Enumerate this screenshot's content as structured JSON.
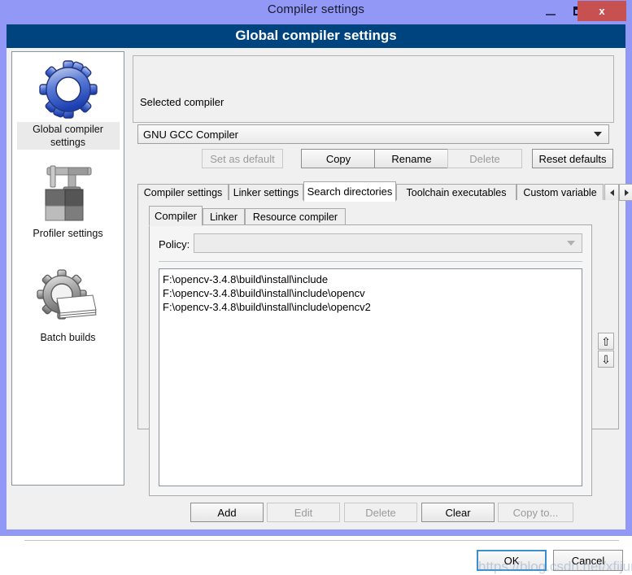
{
  "window": {
    "title": "Compiler settings",
    "minimize_label": "minimize",
    "maximize_label": "restore",
    "close_label": "x",
    "titlebar_color": "#9198f5",
    "header_color": "#00447f"
  },
  "header": {
    "title": "Global compiler settings"
  },
  "sidebar": {
    "items": [
      {
        "label": "Global compiler settings",
        "icon": "blue-gear-icon",
        "selected": true
      },
      {
        "label": "Profiler settings",
        "icon": "caliper-blocks-icon",
        "selected": false
      },
      {
        "label": "Batch builds",
        "icon": "gray-gear-pages-icon",
        "selected": false
      }
    ]
  },
  "selected_compiler": {
    "legend": "Selected compiler",
    "value": "GNU GCC Compiler",
    "buttons": [
      {
        "label": "Set as default",
        "enabled": false
      },
      {
        "label": "Copy",
        "enabled": true
      },
      {
        "label": "Rename",
        "enabled": true
      },
      {
        "label": "Delete",
        "enabled": false
      },
      {
        "label": "Reset defaults",
        "enabled": true
      }
    ]
  },
  "tabs": [
    {
      "label": "Compiler settings",
      "active": false
    },
    {
      "label": "Linker settings",
      "active": false
    },
    {
      "label": "Search directories",
      "active": true
    },
    {
      "label": "Toolchain executables",
      "active": false
    },
    {
      "label": "Custom variable",
      "active": false
    }
  ],
  "tab_scroll": {
    "left": "left-arrow-icon",
    "right": "right-arrow-icon"
  },
  "inner_tabs": [
    {
      "label": "Compiler",
      "active": true
    },
    {
      "label": "Linker",
      "active": false
    },
    {
      "label": "Resource compiler",
      "active": false
    }
  ],
  "policy": {
    "label": "Policy:",
    "value": "",
    "enabled": false
  },
  "directories": [
    "F:\\opencv-3.4.8\\build\\install\\include",
    "F:\\opencv-3.4.8\\build\\install\\include\\opencv",
    "F:\\opencv-3.4.8\\build\\install\\include\\opencv2"
  ],
  "move_buttons": {
    "up": "⇧",
    "down": "⇩"
  },
  "list_actions": [
    {
      "label": "Add",
      "enabled": true
    },
    {
      "label": "Edit",
      "enabled": false
    },
    {
      "label": "Delete",
      "enabled": false
    },
    {
      "label": "Clear",
      "enabled": true
    },
    {
      "label": "Copy to...",
      "enabled": false
    }
  ],
  "dialog_buttons": {
    "ok": "OK",
    "cancel": "Cancel"
  },
  "watermark": "https://blog.csdn.net/xfijun"
}
